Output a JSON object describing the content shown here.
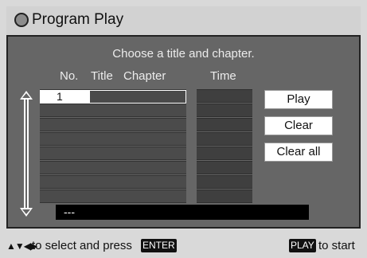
{
  "header": {
    "title": "Program Play"
  },
  "panel": {
    "prompt": "Choose a title and chapter.",
    "columns": {
      "no": "No.",
      "title": "Title",
      "chapter": "Chapter",
      "time": "Time"
    },
    "rows": [
      {
        "no": "1",
        "selected": true
      },
      {
        "no": "",
        "selected": false
      },
      {
        "no": "",
        "selected": false
      },
      {
        "no": "",
        "selected": false
      },
      {
        "no": "",
        "selected": false
      },
      {
        "no": "",
        "selected": false
      },
      {
        "no": "",
        "selected": false
      },
      {
        "no": "",
        "selected": false
      }
    ],
    "buttons": {
      "play": "Play",
      "clear": "Clear",
      "clear_all": "Clear all"
    },
    "info": "---"
  },
  "footer": {
    "nav_symbols": "▲▼◀▶",
    "text_select": "to select and press",
    "enter_key": "ENTER",
    "play_key": "PLAY",
    "text_start": "to start"
  },
  "icons": {
    "header_circle": "disc-circle-icon",
    "scroll": "scroll-arrows-icon"
  }
}
